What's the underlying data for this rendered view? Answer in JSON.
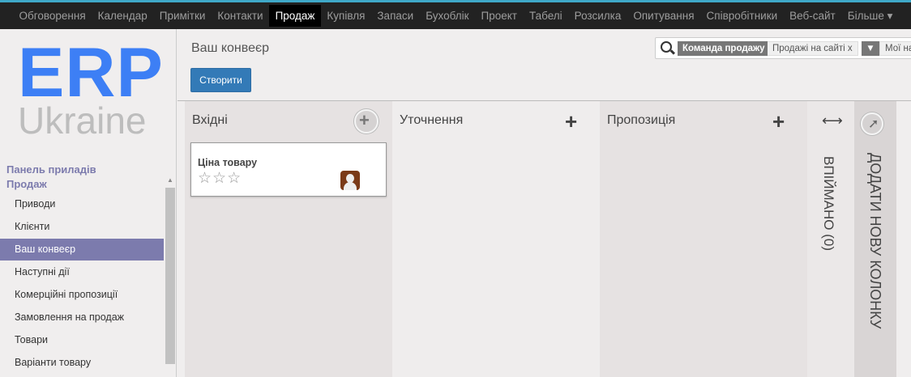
{
  "colors": {
    "nav_bg": "#222222",
    "accent": "#7c7bad",
    "primary": "#337ab7",
    "logo_blue": "#3d7ff5"
  },
  "nav": {
    "items": [
      "Обговорення",
      "Календар",
      "Примітки",
      "Контакти",
      "Продаж",
      "Купівля",
      "Запаси",
      "Бухоблік",
      "Проект",
      "Табелі",
      "Розсилка",
      "Опитування",
      "Співробітники",
      "Веб-сайт",
      "Більше ▾"
    ],
    "active": "Продаж"
  },
  "logo": {
    "line1": "ERP",
    "line2": "Ukraine"
  },
  "sidebar": {
    "section1": "Панель приладів",
    "section2": "Продаж",
    "items": [
      {
        "label": "Приводи"
      },
      {
        "label": "Клієнти"
      },
      {
        "label": "Ваш конвеєр",
        "active": true
      },
      {
        "label": "Наступні дії"
      },
      {
        "label": "Комерційні пропозиції"
      },
      {
        "label": "Замовлення на продаж"
      },
      {
        "label": "Товари"
      },
      {
        "label": "Варіанти товару"
      }
    ]
  },
  "header": {
    "title": "Ваш конвеєр",
    "create_label": "Створити"
  },
  "search": {
    "facets": [
      {
        "label": "Команда продажу",
        "value": "Продажі на сайті",
        "remove": "x"
      },
      {
        "icon": "filter-icon",
        "value": "Мої на"
      }
    ]
  },
  "kanban": {
    "columns": [
      {
        "title": "Вхідні",
        "cards": [
          {
            "title": "Ціна товару",
            "stars": 0,
            "max_stars": 3
          }
        ]
      },
      {
        "title": "Уточнення",
        "cards": []
      },
      {
        "title": "Пропозиція",
        "cards": []
      }
    ],
    "folded": {
      "title": "ВПІЙМАНО (0)"
    },
    "add_column": "ДОДАТИ НОВУ КОЛОНКУ"
  }
}
